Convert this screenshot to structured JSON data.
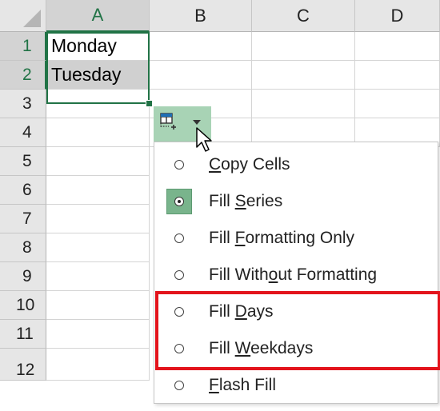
{
  "columns": [
    "A",
    "B",
    "C",
    "D"
  ],
  "rows": [
    "1",
    "2",
    "3",
    "4",
    "5",
    "6",
    "7",
    "8",
    "9",
    "10",
    "11",
    "12"
  ],
  "cells": {
    "A1": "Monday",
    "A2": "Tuesday"
  },
  "autofill_menu": {
    "items": [
      {
        "id": "copy-cells",
        "before": "",
        "key": "C",
        "after": "opy Cells",
        "checked": false
      },
      {
        "id": "fill-series",
        "before": "Fill ",
        "key": "S",
        "after": "eries",
        "checked": true
      },
      {
        "id": "fill-formatting-only",
        "before": "Fill ",
        "key": "F",
        "after": "ormatting Only",
        "checked": false
      },
      {
        "id": "fill-without-formatting",
        "before": "Fill With",
        "key": "o",
        "after": "ut Formatting",
        "checked": false
      },
      {
        "id": "fill-days",
        "before": "Fill ",
        "key": "D",
        "after": "ays",
        "checked": false
      },
      {
        "id": "fill-weekdays",
        "before": "Fill ",
        "key": "W",
        "after": "eekdays",
        "checked": false
      },
      {
        "id": "flash-fill",
        "before": "",
        "key": "F",
        "after": "lash Fill",
        "checked": false
      }
    ]
  },
  "colors": {
    "accent": "#217346",
    "highlight_box": "#e3141c",
    "button_bg": "#a8d3b5"
  }
}
